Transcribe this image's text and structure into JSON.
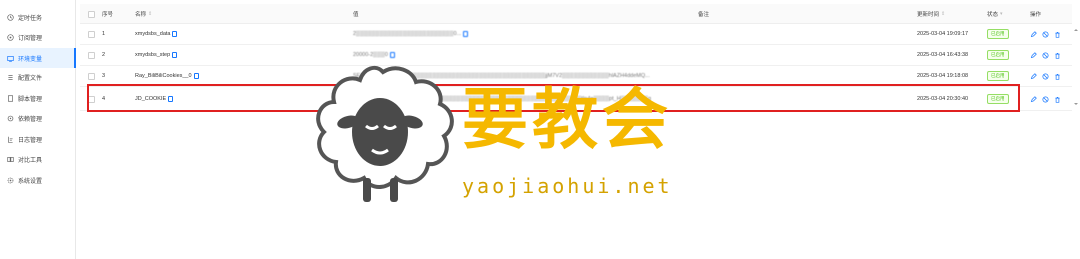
{
  "sidebar": {
    "items": [
      {
        "label": "定时任务",
        "icon": "clock-icon"
      },
      {
        "label": "订阅管理",
        "icon": "subscribe-icon"
      },
      {
        "label": "环境变量",
        "icon": "env-icon",
        "active": true
      },
      {
        "label": "配置文件",
        "icon": "config-icon"
      },
      {
        "label": "脚本管理",
        "icon": "script-icon"
      },
      {
        "label": "依赖管理",
        "icon": "dependency-icon"
      },
      {
        "label": "日志管理",
        "icon": "log-icon"
      },
      {
        "label": "对比工具",
        "icon": "diff-icon"
      },
      {
        "label": "系统设置",
        "icon": "settings-icon"
      }
    ]
  },
  "table": {
    "headers": {
      "index": "序号",
      "name": "名称",
      "value": "值",
      "remark": "备注",
      "updated": "更新时间",
      "status": "状态",
      "actions": "操作"
    },
    "rows": [
      {
        "index": "1",
        "name": "xmydsbs_data",
        "value": "2▒▒▒▒▒▒▒▒▒▒▒▒▒▒▒▒▒▒▒▒▒▒▒▒▒0...",
        "remark": "",
        "updated": "2025-03-04 19:09:17",
        "status": "已启用"
      },
      {
        "index": "2",
        "name": "xmydsbs_step",
        "value": "20000-2▒▒▒0",
        "remark": "",
        "updated": "2025-03-04 16:43:38",
        "status": "已启用"
      },
      {
        "index": "3",
        "name": "Ray_BiliBiliCookies__0",
        "value": "SESSDATA=0f▒▒▒▒▒▒▒▒▒▒▒▒▒▒▒▒▒▒▒▒▒▒▒▒▒▒▒▒▒▒▒▒▒▒▒▒▒▒▒▒jjM7V2▒▒▒▒▒▒▒▒▒▒▒▒hlAZH4ddeMQ...",
        "remark": "",
        "updated": "2025-03-04 19:18:08",
        "status": "已启用"
      },
      {
        "index": "4",
        "name": "JD_COOKIE",
        "value": "pt_key=AAJ▒▒▒▒▒▒▒▒▒▒▒▒▒▒▒▒▒▒▒▒▒▒▒▒▒▒▒▒▒▒▒▒▒▒▒▒▒▒▒▒▒▒▒▒▒▒▒▒▒▒▒tIn4e▒▒▒▒pt_H▒▒▒▒▒▒▒g",
        "remark": "",
        "updated": "2025-03-04 20:30:40",
        "status": "已启用"
      }
    ]
  },
  "watermark": {
    "title": "要教会",
    "url": "yaojiaohui.net"
  },
  "colors": {
    "accent": "#1677ff",
    "highlight": "#e02020",
    "watermark": "#f5b800",
    "status_green": "#52c41a"
  }
}
